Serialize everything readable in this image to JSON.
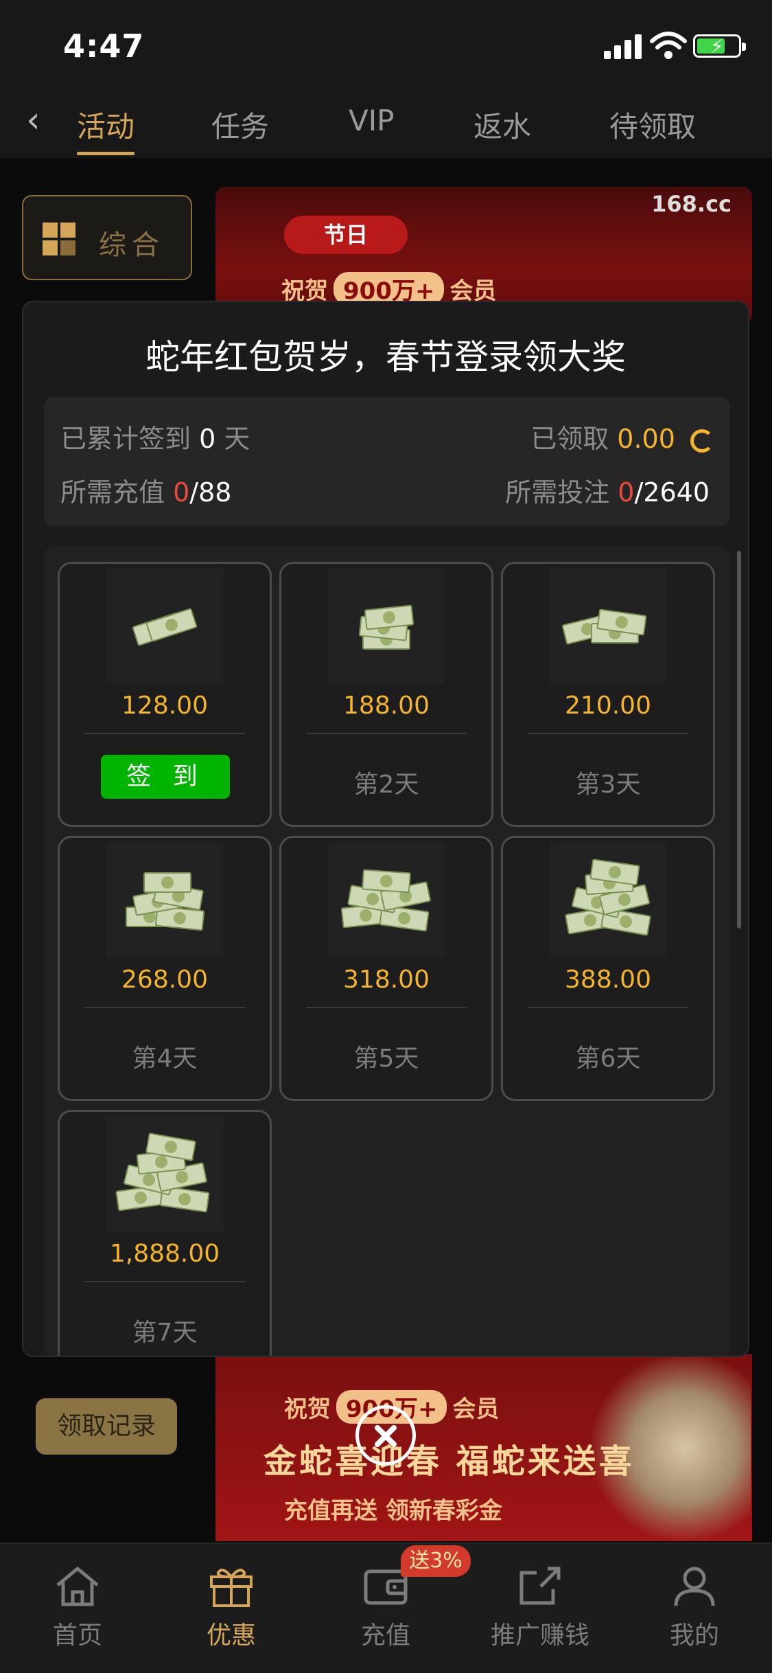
{
  "status_bar": {
    "time": "4:47"
  },
  "top_tabs": [
    {
      "label": "活动",
      "active": true
    },
    {
      "label": "任务",
      "active": false
    },
    {
      "label": "VIP",
      "active": false
    },
    {
      "label": "返水",
      "active": false
    },
    {
      "label": "待领取",
      "active": false
    }
  ],
  "category": {
    "label": "综合"
  },
  "banner_top": {
    "site": "168.cc",
    "tag": "节日",
    "text_prefix": "祝贺",
    "text_num": "900万+",
    "text_suffix": "会员"
  },
  "banner_bottom": {
    "text_prefix": "祝贺",
    "text_num": "900万+",
    "text_suffix": "会员",
    "headline": "金蛇喜迎春 福蛇来送喜",
    "subline": "充值再送 领新春彩金"
  },
  "record_button": "领取记录",
  "modal": {
    "title": "蛇年红包贺岁，春节登录领大奖",
    "stats": {
      "signed_label": "已累计签到",
      "signed_days": "0",
      "signed_unit": "天",
      "claimed_label": "已领取",
      "claimed_value": "0.00",
      "deposit_label": "所需充值",
      "deposit_current": "0",
      "deposit_total": "/88",
      "bet_label": "所需投注",
      "bet_current": "0",
      "bet_total": "/2640"
    },
    "rewards": [
      {
        "amount": "128.00",
        "day": "签 到",
        "claimable": true
      },
      {
        "amount": "188.00",
        "day": "第2天",
        "claimable": false
      },
      {
        "amount": "210.00",
        "day": "第3天",
        "claimable": false
      },
      {
        "amount": "268.00",
        "day": "第4天",
        "claimable": false
      },
      {
        "amount": "318.00",
        "day": "第5天",
        "claimable": false
      },
      {
        "amount": "388.00",
        "day": "第6天",
        "claimable": false
      },
      {
        "amount": "1,888.00",
        "day": "第7天",
        "claimable": false
      }
    ]
  },
  "bottom_nav": [
    {
      "label": "首页",
      "icon": "home-icon",
      "active": false
    },
    {
      "label": "优惠",
      "icon": "gift-icon",
      "active": true
    },
    {
      "label": "充值",
      "icon": "wallet-icon",
      "active": false
    },
    {
      "label": "推广赚钱",
      "icon": "share-icon",
      "active": false
    },
    {
      "label": "我的",
      "icon": "user-icon",
      "active": false
    }
  ],
  "recharge_badge": "送3%",
  "colors": {
    "gold": "#d4a65a",
    "amount": "#f5b52a",
    "red": "#e84a3c",
    "green": "#00b400"
  }
}
